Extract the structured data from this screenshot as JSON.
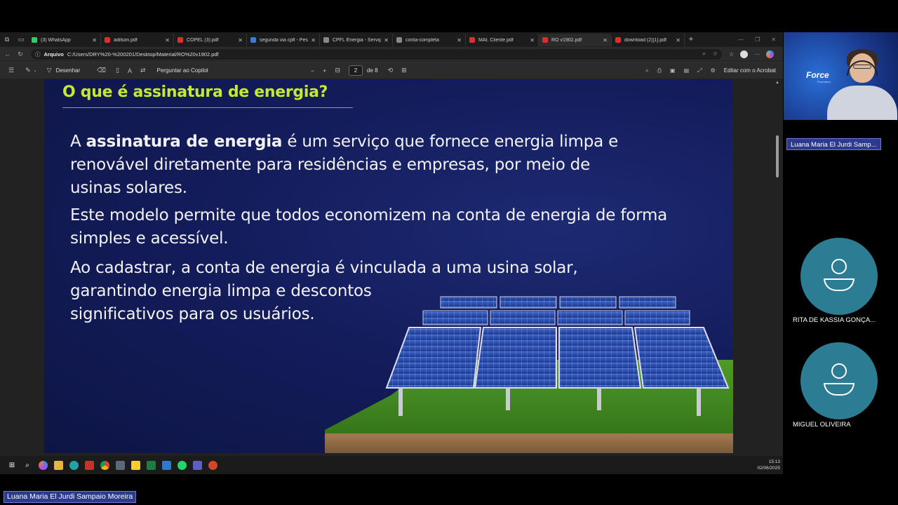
{
  "browser": {
    "tabs": [
      {
        "label": "(3) WhatsApp",
        "color": "#25d366",
        "active": false
      },
      {
        "label": "adilson.pdf",
        "color": "#d9302c",
        "active": false
      },
      {
        "label": "COPEL (3).pdf",
        "color": "#d9302c",
        "active": false
      },
      {
        "label": "segunda via cpfl - Pes",
        "color": "#3a7bd5",
        "active": false
      },
      {
        "label": "CPFL Energia - Serviç",
        "color": "#888888",
        "active": false
      },
      {
        "label": "conta-completa",
        "color": "#888888",
        "active": false
      },
      {
        "label": "MAt. Cliente.pdf",
        "color": "#d9302c",
        "active": false
      },
      {
        "label": "RO v1902.pdf",
        "color": "#d9302c",
        "active": true
      },
      {
        "label": "download (2)[1].pdf",
        "color": "#d9302c",
        "active": false
      }
    ],
    "address": {
      "source_label": "Arquivo",
      "url": "C:/Users/DRY%20-%200201/Desktop/Material/RO%20v1902.pdf"
    }
  },
  "pdf_toolbar": {
    "draw_label": "Desenhar",
    "copilot_label": "Perguntar ao Copilot",
    "page_current": "2",
    "page_total": "de 8",
    "acrobat_label": "Editar com o Acrobat"
  },
  "slide": {
    "title": "O que é assinatura de energia?",
    "p1_pre": "A ",
    "p1_bold": "assinatura de energia",
    "p1_post": " é um serviço que fornece energia limpa e renovável diretamente para residências e empresas, por meio de usinas solares.",
    "p2": "Este modelo permite que todos economizem na conta de energia de forma simples e acessível.",
    "p3_line1": "Ao cadastrar, a conta de energia é vinculada a uma usina solar,",
    "p3_line2": "garantindo energia limpa e descontos",
    "p3_line3": "significativos para os usuários."
  },
  "taskbar": {
    "time": "15:13",
    "date": "02/06/2025"
  },
  "meeting": {
    "speaker_logo": "Force",
    "speaker_logo_sub": "Promotora",
    "speaker_name": "Luana Maria El Jurdi Samp...",
    "participants": [
      {
        "name": "RITA DE KASSIA GONÇA..."
      },
      {
        "name": "MIGUEL OLIVEIRA"
      }
    ],
    "presenter_full_name": "Luana Maria El Jurdi Sampaio Moreira"
  }
}
